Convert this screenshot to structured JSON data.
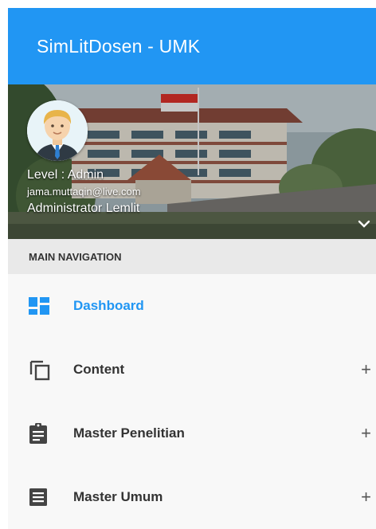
{
  "app": {
    "title": "SimLitDosen - UMK"
  },
  "user": {
    "level": "Level : Admin",
    "email": "jama.muttaqin@live.com",
    "name": "Administrator Lemlit"
  },
  "nav": {
    "header": "MAIN NAVIGATION",
    "items": [
      {
        "label": "Dashboard",
        "icon": "dashboard-icon",
        "active": true
      },
      {
        "label": "Content",
        "icon": "copy-icon",
        "expand": "+"
      },
      {
        "label": "Master Penelitian",
        "icon": "assignment-icon",
        "expand": "+"
      },
      {
        "label": "Master Umum",
        "icon": "list-icon",
        "expand": "+"
      }
    ]
  },
  "colors": {
    "primary": "#2196f3",
    "nav_header_bg": "#e9e9e9"
  }
}
